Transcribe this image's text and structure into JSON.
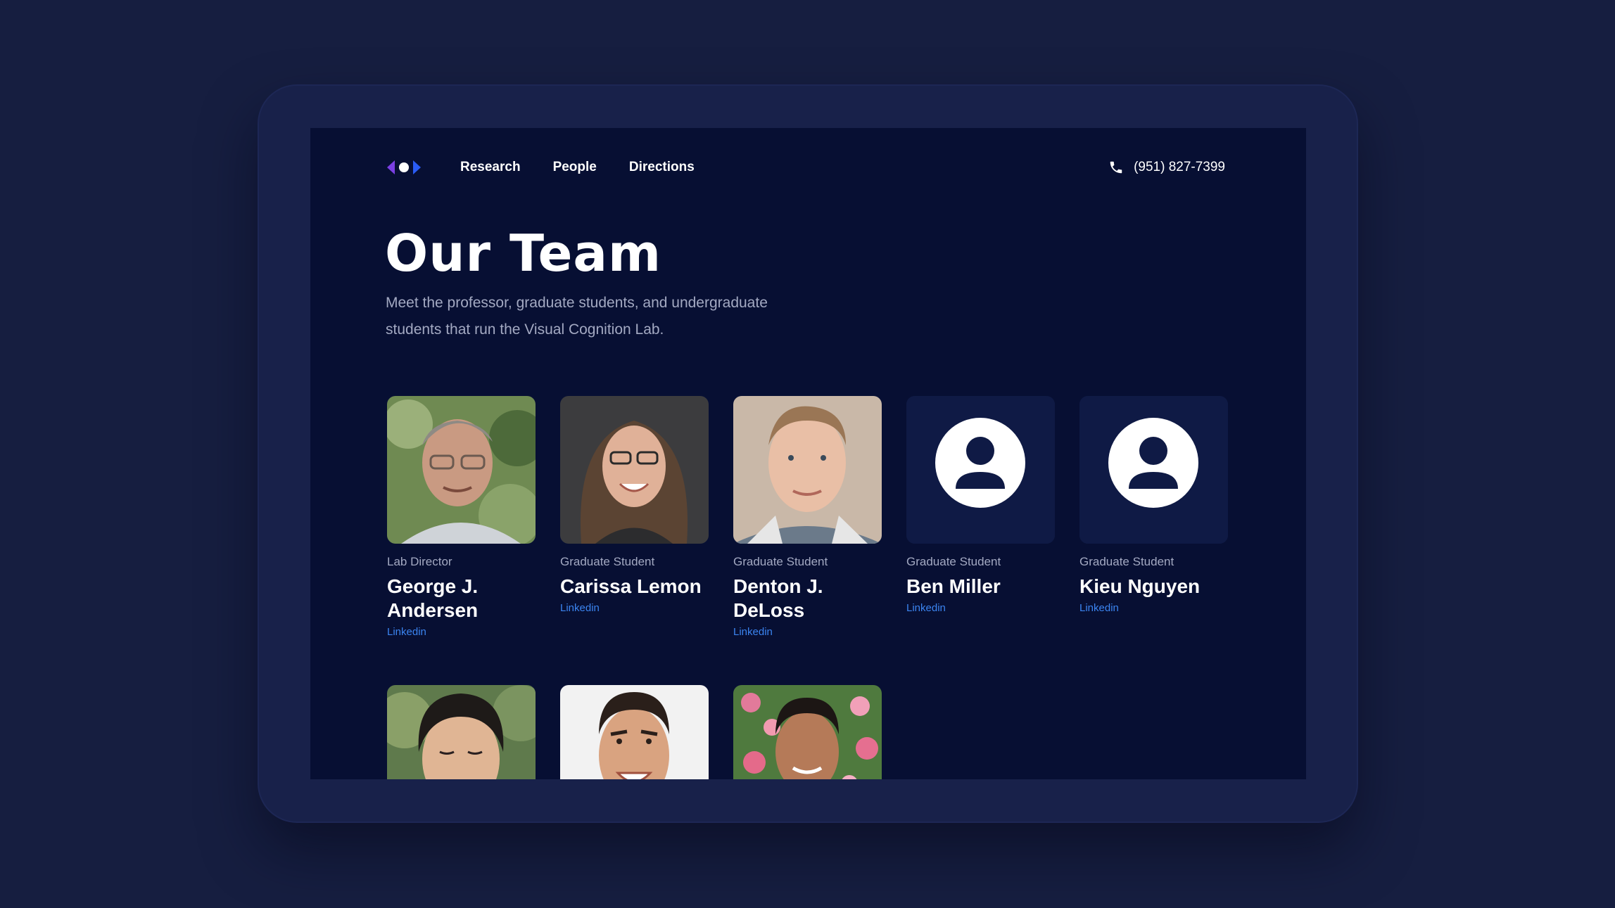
{
  "nav": {
    "logo": "lab-logo-icon",
    "links": [
      "Research",
      "People",
      "Directions"
    ],
    "phone_icon": "phone-icon",
    "phone": "(951) 827-7399"
  },
  "hero": {
    "title": "Our Team",
    "subtitle": "Meet the professor, graduate students, and undergraduate students that run the Visual Cognition Lab."
  },
  "team": [
    {
      "role": "Lab Director",
      "name": "George J. Andersen",
      "link": "Linkedin",
      "photo": "portrait-photo"
    },
    {
      "role": "Graduate Student",
      "name": "Carissa Lemon",
      "link": "Linkedin",
      "photo": "portrait-photo"
    },
    {
      "role": "Graduate Student",
      "name": "Denton J. DeLoss",
      "link": "Linkedin",
      "photo": "portrait-photo"
    },
    {
      "role": "Graduate Student",
      "name": "Ben Miller",
      "link": "Linkedin",
      "photo": "user-avatar-icon"
    },
    {
      "role": "Graduate Student",
      "name": "Kieu Nguyen",
      "link": "Linkedin",
      "photo": "user-avatar-icon"
    },
    {
      "photo": "portrait-photo"
    },
    {
      "photo": "portrait-photo"
    },
    {
      "photo": "portrait-photo"
    }
  ],
  "colors": {
    "page_bg": "#161e40",
    "bezel": "#18214a",
    "screen_bg": "#070f33",
    "avatar_bg": "#0f1a45",
    "link": "#3b84f0",
    "muted_text": "#a3a9c2"
  }
}
